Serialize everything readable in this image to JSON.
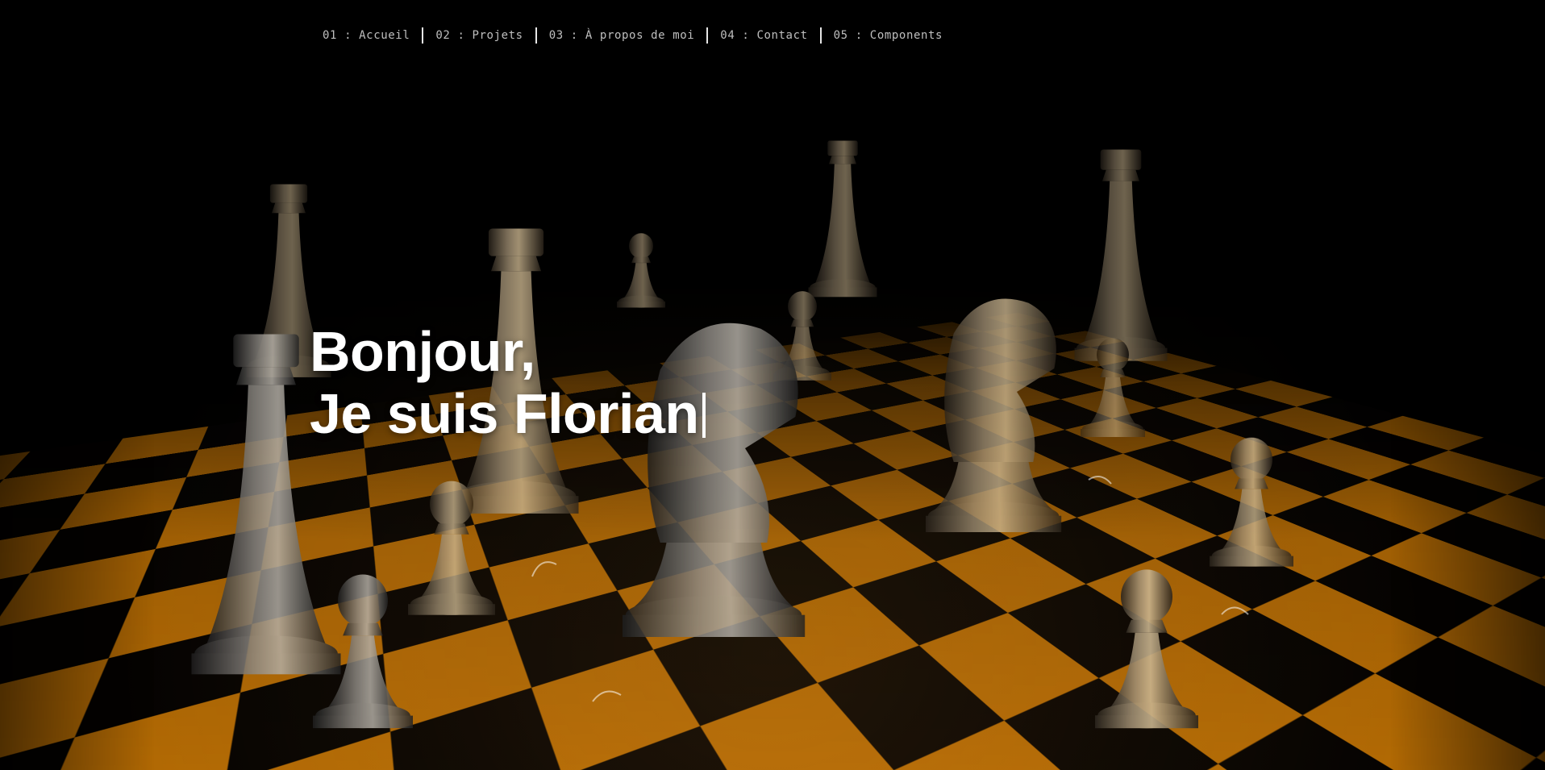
{
  "nav": {
    "items": [
      {
        "label": "01 : Accueil"
      },
      {
        "label": "02 : Projets"
      },
      {
        "label": "03 : À propos de moi"
      },
      {
        "label": "04 : Contact"
      },
      {
        "label": "05 : Components"
      }
    ]
  },
  "hero": {
    "line1": "Bonjour,",
    "line2": "Je suis Florian",
    "background": "chessboard-photo"
  },
  "colors": {
    "text": "#ffffff",
    "nav_text": "#bfbfbf",
    "background": "#000000",
    "board_light": "#b5700f",
    "board_dark": "#050302",
    "piece_metal": "#9a8a72"
  }
}
